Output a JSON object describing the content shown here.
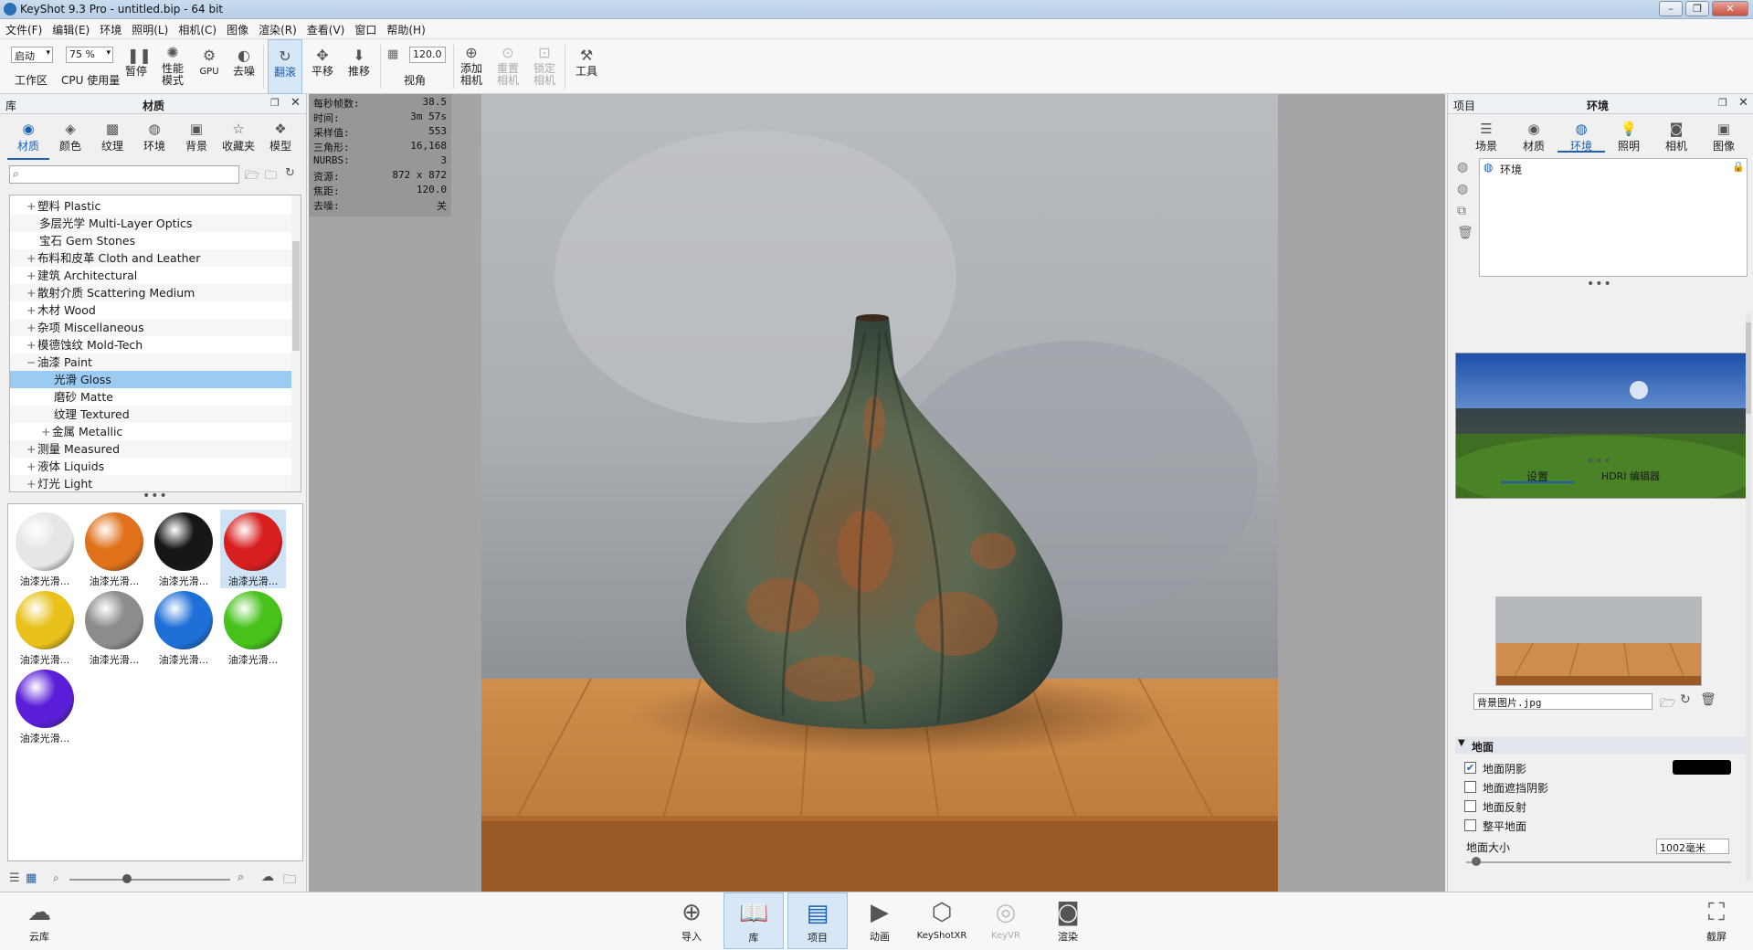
{
  "titlebar": {
    "title": "KeyShot 9.3 Pro  - untitled.bip  - 64 bit"
  },
  "menu": [
    "文件(F)",
    "编辑(E)",
    "环境",
    "照明(L)",
    "相机(C)",
    "图像",
    "渲染(R)",
    "查看(V)",
    "窗口",
    "帮助(H)"
  ],
  "toolbar": {
    "workspace_value": "启动",
    "workspace_label": "工作区",
    "cpu_value": "75 %",
    "cpu_label": "CPU 使用量",
    "pause": "暂停",
    "perf": "性能模式",
    "gpu": "GPU",
    "denoise": "去噪",
    "flip": "翻滚",
    "pan": "平移",
    "push": "推移",
    "fov_value": "120.0",
    "fov_label": "视角",
    "add_camera": "添加相机",
    "reset_camera": "重置相机",
    "lock_camera": "锁定相机",
    "tools": "工具"
  },
  "library": {
    "left_title": "库",
    "title": "材质",
    "tabs": [
      "材质",
      "颜色",
      "纹理",
      "环境",
      "背景",
      "收藏夹",
      "模型"
    ],
    "tree": [
      {
        "exp": "+",
        "label": "塑料 Plastic"
      },
      {
        "exp": "",
        "label": "多层光学 Multi-Layer Optics"
      },
      {
        "exp": "",
        "label": "宝石 Gem Stones"
      },
      {
        "exp": "+",
        "label": "布料和皮革 Cloth and Leather"
      },
      {
        "exp": "+",
        "label": "建筑 Architectural"
      },
      {
        "exp": "+",
        "label": "散射介质 Scattering Medium"
      },
      {
        "exp": "+",
        "label": "木材 Wood"
      },
      {
        "exp": "+",
        "label": "杂项 Miscellaneous"
      },
      {
        "exp": "+",
        "label": "模德蚀纹 Mold-Tech"
      },
      {
        "exp": "−",
        "label": "油漆 Paint"
      },
      {
        "exp": "",
        "label": "光滑 Gloss"
      },
      {
        "exp": "",
        "label": "磨砂 Matte"
      },
      {
        "exp": "",
        "label": "纹理 Textured"
      },
      {
        "exp": "+",
        "label": "金属 Metallic"
      },
      {
        "exp": "+",
        "label": "测量 Measured"
      },
      {
        "exp": "+",
        "label": "液体 Liquids"
      },
      {
        "exp": "+",
        "label": "灯光 Light"
      }
    ],
    "thumbs": [
      {
        "label": "油漆光滑...",
        "color": "#e6e6e6"
      },
      {
        "label": "油漆光滑...",
        "color": "#e0701a"
      },
      {
        "label": "油漆光滑...",
        "color": "#161616"
      },
      {
        "label": "油漆光滑...",
        "color": "#d81e1e"
      },
      {
        "label": "油漆光滑...",
        "color": "#e8c21a"
      },
      {
        "label": "油漆光滑...",
        "color": "#8c8c8c"
      },
      {
        "label": "油漆光滑...",
        "color": "#1e6fd8"
      },
      {
        "label": "油漆光滑...",
        "color": "#46c21a"
      },
      {
        "label": "油漆光滑...",
        "color": "#5a1ed8"
      }
    ]
  },
  "hud": [
    {
      "k": "每秒帧数:",
      "v": "38.5"
    },
    {
      "k": "时间:",
      "v": "3m 57s"
    },
    {
      "k": "采样值:",
      "v": "553"
    },
    {
      "k": "三角形:",
      "v": "16,168"
    },
    {
      "k": "NURBS:",
      "v": "3"
    },
    {
      "k": "资源:",
      "v": "872 x 872"
    },
    {
      "k": "焦距:",
      "v": "120.0"
    },
    {
      "k": "去噪:",
      "v": "关"
    }
  ],
  "project": {
    "left_title": "项目",
    "title": "环境",
    "tabs": [
      "场景",
      "材质",
      "环境",
      "照明",
      "相机",
      "图像"
    ],
    "env_item": "环境",
    "subtabs": [
      "设置",
      "HDRI 编辑器"
    ],
    "bg_file": "背景图片.jpg",
    "ground_header": "地面",
    "options": [
      {
        "label": "地面阴影",
        "checked": true
      },
      {
        "label": "地面遮挡阴影",
        "checked": false
      },
      {
        "label": "地面反射",
        "checked": false
      },
      {
        "label": "整平地面",
        "checked": false
      }
    ],
    "ground_size_label": "地面大小",
    "ground_size_value": "1002毫米"
  },
  "bottombar": {
    "cloud": "云库",
    "items": [
      "导入",
      "库",
      "项目",
      "动画",
      "KeyShotXR",
      "KeyVR",
      "渲染"
    ],
    "screenshot": "截屏"
  },
  "colors": {
    "accent": "#1a5fb4",
    "selection": "#9bcaf2"
  }
}
